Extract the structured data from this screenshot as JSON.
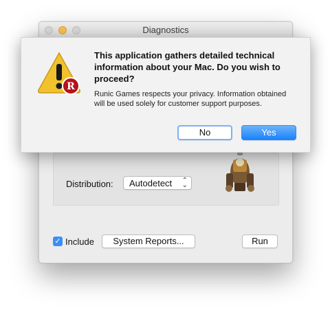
{
  "window": {
    "title": "Diagnostics"
  },
  "main": {
    "distribution_label": "Distribution:",
    "distribution_value": "Autodetect",
    "include_checked": true,
    "include_label": "Include",
    "system_reports_label": "System Reports...",
    "run_label": "Run"
  },
  "alert": {
    "title": "This application gathers detailed technical information about your Mac. Do you wish to proceed?",
    "message": "Runic Games respects your privacy. Information obtained will be used solely for customer support purposes.",
    "no_label": "No",
    "yes_label": "Yes"
  },
  "colors": {
    "accent": "#1a82fb",
    "warning": "#f0c020"
  }
}
